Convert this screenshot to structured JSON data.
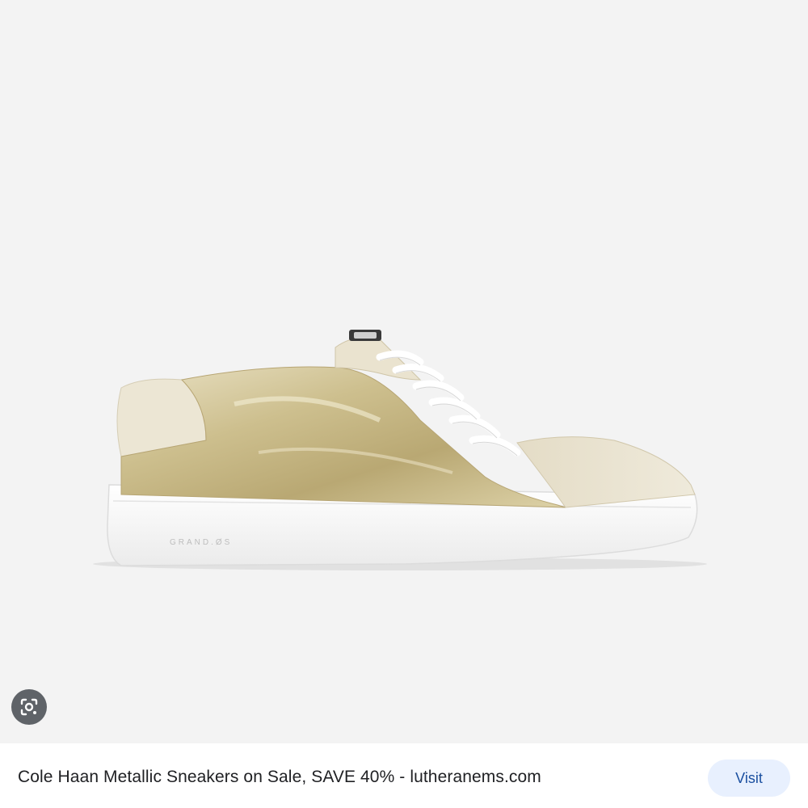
{
  "result": {
    "image_alt": "Cole Haan metallic gold low-top sneaker with white sole",
    "shoe_brand_mark": "GRAND.ØS",
    "caption": "Cole Haan Metallic Sneakers on Sale, SAVE 40% - lutheranems.com",
    "visit_label": "Visit"
  },
  "icons": {
    "lens": "lens-icon"
  },
  "colors": {
    "background": "#f3f3f3",
    "visit_button_bg": "#e8f0fe",
    "visit_button_text": "#1a4fa0",
    "lens_button_bg": "#5f6368"
  }
}
